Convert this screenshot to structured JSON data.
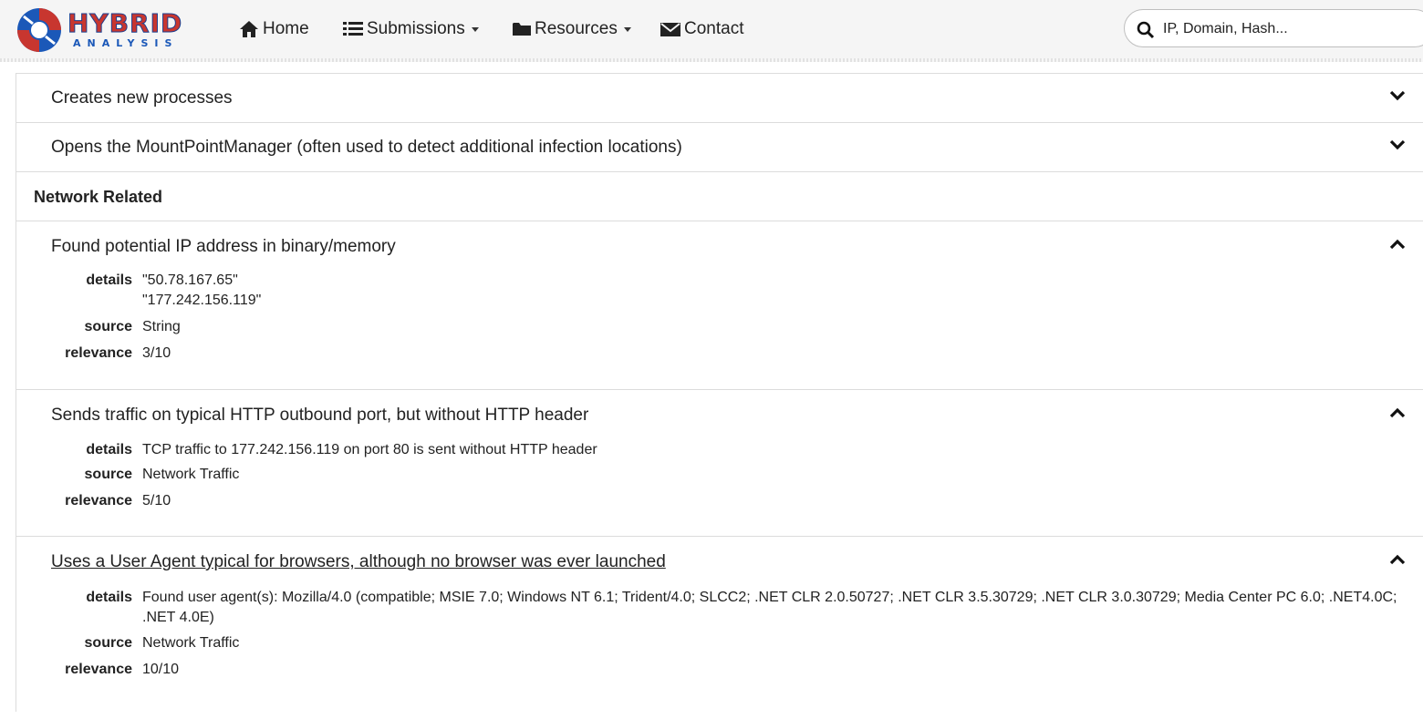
{
  "navbar": {
    "logo_text": "HYBRID",
    "logo_subtext": "ANALYSIS",
    "items": [
      {
        "label": "Home",
        "icon": "home-icon"
      },
      {
        "label": "Submissions",
        "icon": "list-icon"
      },
      {
        "label": "Resources",
        "icon": "folder-icon"
      },
      {
        "label": "Contact",
        "icon": "envelope-icon"
      }
    ],
    "search_placeholder": "IP, Domain, Hash..."
  },
  "signatures": {
    "collapsed_rows": [
      {
        "title": "Creates new processes"
      },
      {
        "title": "Opens the MountPointManager (often used to detect additional infection locations)"
      }
    ],
    "section_title": "Network Related",
    "expanded_rows": [
      {
        "title": "Found potential IP address in binary/memory",
        "details_label": "details",
        "details_lines": [
          "\"50.78.167.65\"",
          "\"177.242.156.119\""
        ],
        "source_label": "source",
        "source": "String",
        "relevance_label": "relevance",
        "relevance": "3/10"
      },
      {
        "title": "Sends traffic on typical HTTP outbound port, but without HTTP header",
        "details_label": "details",
        "details_lines": [
          "TCP traffic to 177.242.156.119 on port 80 is sent without HTTP header"
        ],
        "source_label": "source",
        "source": "Network Traffic",
        "relevance_label": "relevance",
        "relevance": "5/10"
      },
      {
        "title": "Uses a User Agent typical for browsers, although no browser was ever launched",
        "details_label": "details",
        "details_lines": [
          "Found user agent(s): Mozilla/4.0 (compatible; MSIE 7.0; Windows NT 6.1; Trident/4.0; SLCC2; .NET CLR 2.0.50727; .NET CLR 3.5.30729; .NET CLR 3.0.30729; Media Center PC 6.0; .NET4.0C; .NET 4.0E)"
        ],
        "source_label": "source",
        "source": "Network Traffic",
        "relevance_label": "relevance",
        "relevance": "10/10"
      }
    ]
  },
  "colors": {
    "logo_red": "#c8362f",
    "logo_blue": "#1b58b8",
    "border": "#dcdcdc",
    "text": "#222222"
  }
}
